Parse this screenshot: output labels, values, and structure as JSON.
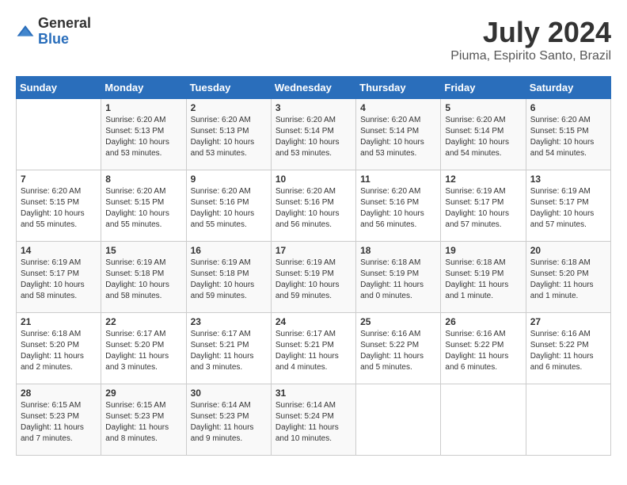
{
  "logo": {
    "general": "General",
    "blue": "Blue"
  },
  "title": {
    "month_year": "July 2024",
    "location": "Piuma, Espirito Santo, Brazil"
  },
  "header": {
    "days": [
      "Sunday",
      "Monday",
      "Tuesday",
      "Wednesday",
      "Thursday",
      "Friday",
      "Saturday"
    ]
  },
  "weeks": [
    [
      {
        "day": "",
        "info": ""
      },
      {
        "day": "1",
        "info": "Sunrise: 6:20 AM\nSunset: 5:13 PM\nDaylight: 10 hours\nand 53 minutes."
      },
      {
        "day": "2",
        "info": "Sunrise: 6:20 AM\nSunset: 5:13 PM\nDaylight: 10 hours\nand 53 minutes."
      },
      {
        "day": "3",
        "info": "Sunrise: 6:20 AM\nSunset: 5:14 PM\nDaylight: 10 hours\nand 53 minutes."
      },
      {
        "day": "4",
        "info": "Sunrise: 6:20 AM\nSunset: 5:14 PM\nDaylight: 10 hours\nand 53 minutes."
      },
      {
        "day": "5",
        "info": "Sunrise: 6:20 AM\nSunset: 5:14 PM\nDaylight: 10 hours\nand 54 minutes."
      },
      {
        "day": "6",
        "info": "Sunrise: 6:20 AM\nSunset: 5:15 PM\nDaylight: 10 hours\nand 54 minutes."
      }
    ],
    [
      {
        "day": "7",
        "info": "Sunrise: 6:20 AM\nSunset: 5:15 PM\nDaylight: 10 hours\nand 55 minutes."
      },
      {
        "day": "8",
        "info": "Sunrise: 6:20 AM\nSunset: 5:15 PM\nDaylight: 10 hours\nand 55 minutes."
      },
      {
        "day": "9",
        "info": "Sunrise: 6:20 AM\nSunset: 5:16 PM\nDaylight: 10 hours\nand 55 minutes."
      },
      {
        "day": "10",
        "info": "Sunrise: 6:20 AM\nSunset: 5:16 PM\nDaylight: 10 hours\nand 56 minutes."
      },
      {
        "day": "11",
        "info": "Sunrise: 6:20 AM\nSunset: 5:16 PM\nDaylight: 10 hours\nand 56 minutes."
      },
      {
        "day": "12",
        "info": "Sunrise: 6:19 AM\nSunset: 5:17 PM\nDaylight: 10 hours\nand 57 minutes."
      },
      {
        "day": "13",
        "info": "Sunrise: 6:19 AM\nSunset: 5:17 PM\nDaylight: 10 hours\nand 57 minutes."
      }
    ],
    [
      {
        "day": "14",
        "info": "Sunrise: 6:19 AM\nSunset: 5:17 PM\nDaylight: 10 hours\nand 58 minutes."
      },
      {
        "day": "15",
        "info": "Sunrise: 6:19 AM\nSunset: 5:18 PM\nDaylight: 10 hours\nand 58 minutes."
      },
      {
        "day": "16",
        "info": "Sunrise: 6:19 AM\nSunset: 5:18 PM\nDaylight: 10 hours\nand 59 minutes."
      },
      {
        "day": "17",
        "info": "Sunrise: 6:19 AM\nSunset: 5:19 PM\nDaylight: 10 hours\nand 59 minutes."
      },
      {
        "day": "18",
        "info": "Sunrise: 6:18 AM\nSunset: 5:19 PM\nDaylight: 11 hours\nand 0 minutes."
      },
      {
        "day": "19",
        "info": "Sunrise: 6:18 AM\nSunset: 5:19 PM\nDaylight: 11 hours\nand 1 minute."
      },
      {
        "day": "20",
        "info": "Sunrise: 6:18 AM\nSunset: 5:20 PM\nDaylight: 11 hours\nand 1 minute."
      }
    ],
    [
      {
        "day": "21",
        "info": "Sunrise: 6:18 AM\nSunset: 5:20 PM\nDaylight: 11 hours\nand 2 minutes."
      },
      {
        "day": "22",
        "info": "Sunrise: 6:17 AM\nSunset: 5:20 PM\nDaylight: 11 hours\nand 3 minutes."
      },
      {
        "day": "23",
        "info": "Sunrise: 6:17 AM\nSunset: 5:21 PM\nDaylight: 11 hours\nand 3 minutes."
      },
      {
        "day": "24",
        "info": "Sunrise: 6:17 AM\nSunset: 5:21 PM\nDaylight: 11 hours\nand 4 minutes."
      },
      {
        "day": "25",
        "info": "Sunrise: 6:16 AM\nSunset: 5:22 PM\nDaylight: 11 hours\nand 5 minutes."
      },
      {
        "day": "26",
        "info": "Sunrise: 6:16 AM\nSunset: 5:22 PM\nDaylight: 11 hours\nand 6 minutes."
      },
      {
        "day": "27",
        "info": "Sunrise: 6:16 AM\nSunset: 5:22 PM\nDaylight: 11 hours\nand 6 minutes."
      }
    ],
    [
      {
        "day": "28",
        "info": "Sunrise: 6:15 AM\nSunset: 5:23 PM\nDaylight: 11 hours\nand 7 minutes."
      },
      {
        "day": "29",
        "info": "Sunrise: 6:15 AM\nSunset: 5:23 PM\nDaylight: 11 hours\nand 8 minutes."
      },
      {
        "day": "30",
        "info": "Sunrise: 6:14 AM\nSunset: 5:23 PM\nDaylight: 11 hours\nand 9 minutes."
      },
      {
        "day": "31",
        "info": "Sunrise: 6:14 AM\nSunset: 5:24 PM\nDaylight: 11 hours\nand 10 minutes."
      },
      {
        "day": "",
        "info": ""
      },
      {
        "day": "",
        "info": ""
      },
      {
        "day": "",
        "info": ""
      }
    ]
  ]
}
